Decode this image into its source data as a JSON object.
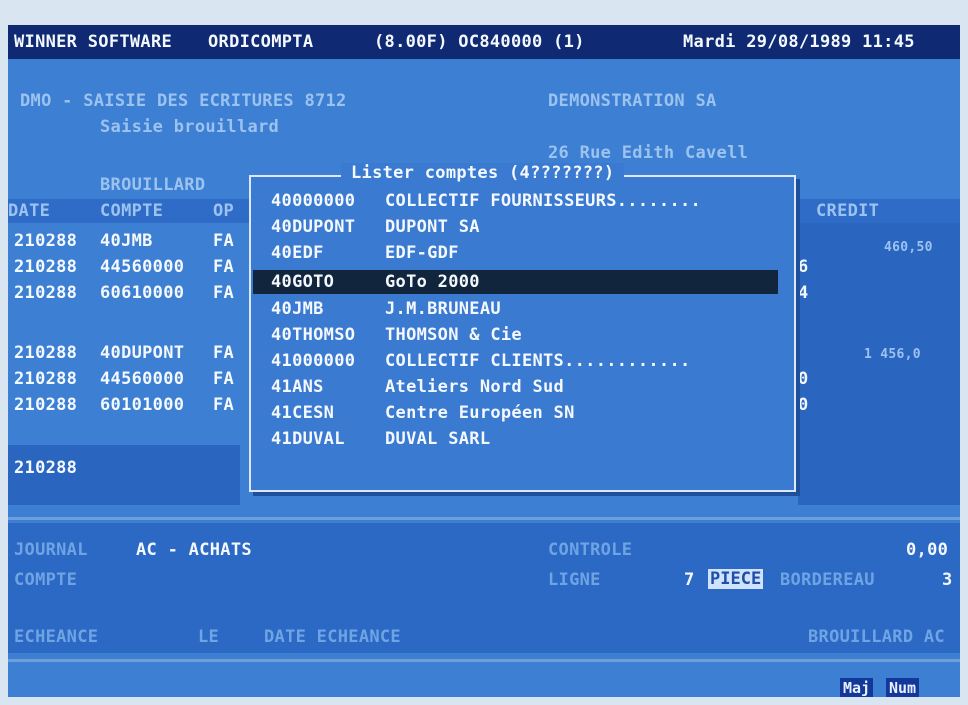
{
  "titlebar": {
    "vendor": "WINNER SOFTWARE",
    "app": "ORDICOMPTA",
    "version": "(8.00F) OC840000 (1)",
    "datetime": "Mardi 29/08/1989 11:45"
  },
  "header": {
    "screen_title": "DMO - SAISIE DES ECRITURES 8712",
    "screen_subtitle": "Saisie brouillard",
    "company_name": "DEMONSTRATION SA",
    "company_address": "26 Rue Edith Cavell",
    "section_label": "BROUILLARD"
  },
  "table": {
    "columns": {
      "date": "DATE",
      "compte": "COMPTE",
      "op": "OP",
      "credit": "CREDIT"
    },
    "rows": [
      {
        "date": "210288",
        "compte": "40JMB",
        "op": "FA",
        "right": "",
        "credit": "460,50"
      },
      {
        "date": "210288",
        "compte": "44560000",
        "op": "FA",
        "right": "6",
        "credit": ""
      },
      {
        "date": "210288",
        "compte": "60610000",
        "op": "FA",
        "right": "4",
        "credit": ""
      },
      {
        "date": "210288",
        "compte": "40DUPONT",
        "op": "FA",
        "right": "",
        "credit": "1 456,0"
      },
      {
        "date": "210288",
        "compte": "44560000",
        "op": "FA",
        "right": "0",
        "credit": ""
      },
      {
        "date": "210288",
        "compte": "60101000",
        "op": "FA",
        "right": "0",
        "credit": ""
      },
      {
        "date": "210288",
        "compte": "",
        "op": "",
        "right": "",
        "credit": ""
      }
    ]
  },
  "popup": {
    "title": "Lister comptes (4???????)",
    "selected_index": 3,
    "items": [
      {
        "code": "40000000",
        "name": "COLLECTIF FOURNISSEURS........"
      },
      {
        "code": "40DUPONT",
        "name": "DUPONT SA"
      },
      {
        "code": "40EDF",
        "name": "EDF-GDF"
      },
      {
        "code": "40GOTO",
        "name": "GoTo 2000"
      },
      {
        "code": "40JMB",
        "name": "J.M.BRUNEAU"
      },
      {
        "code": "40THOMSO",
        "name": "THOMSON & Cie"
      },
      {
        "code": "41000000",
        "name": "COLLECTIF CLIENTS............"
      },
      {
        "code": "41ANS",
        "name": "Ateliers Nord Sud"
      },
      {
        "code": "41CESN",
        "name": "Centre Européen SN"
      },
      {
        "code": "41DUVAL",
        "name": "DUVAL SARL"
      }
    ]
  },
  "footer": {
    "journal_label": "JOURNAL",
    "journal_value": "AC - ACHATS",
    "compte_label": "COMPTE",
    "controle_label": "CONTROLE",
    "controle_value": "0,00",
    "ligne_label": "LIGNE",
    "ligne_value": "7",
    "piece_label": "PIECE",
    "bordereau_label": "BORDEREAU",
    "bordereau_value": "3",
    "echeance_label": "ECHEANCE",
    "le_label": "LE",
    "date_echeance_label": "DATE ECHEANCE",
    "mode_label": "BROUILLARD AC"
  },
  "statusbar": {
    "maj": "Maj",
    "num": "Num"
  },
  "colors": {
    "screen": "#3d7fd2",
    "titlebar": "#0f2a72",
    "selection": "#11263d",
    "text": "#f4f8ff"
  }
}
